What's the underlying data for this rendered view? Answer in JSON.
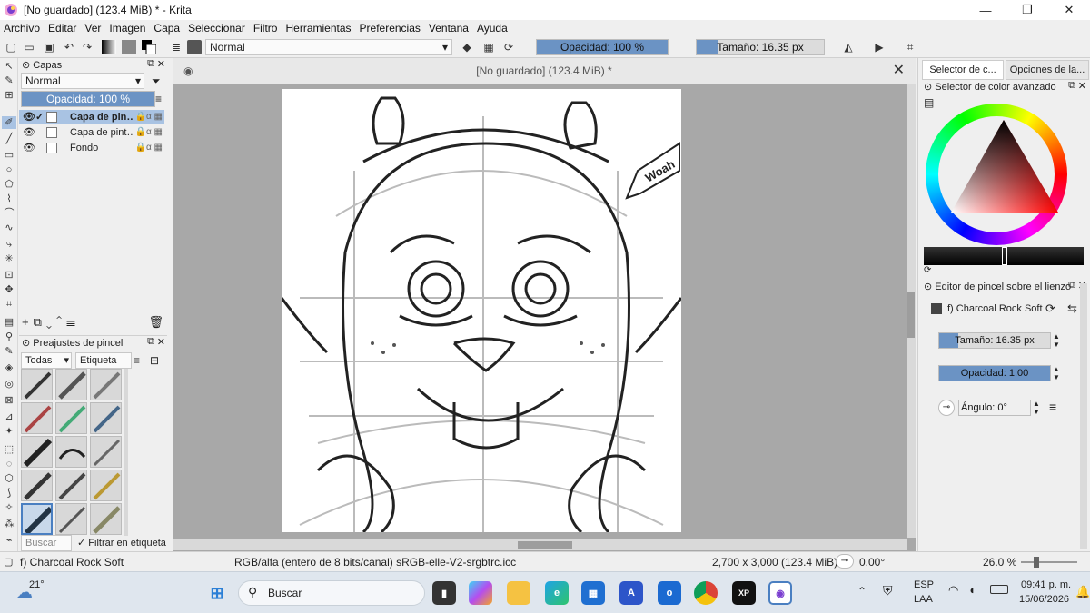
{
  "window": {
    "title": "[No guardado]  (123.4 MiB) * - Krita",
    "minimize": "—",
    "maximize": "❐",
    "close": "✕"
  },
  "menu": [
    "Archivo",
    "Editar",
    "Ver",
    "Imagen",
    "Capa",
    "Seleccionar",
    "Filtro",
    "Herramientas",
    "Preferencias",
    "Ventana",
    "Ayuda"
  ],
  "toolbar": {
    "blend_mode": "Normal",
    "opacity": "Opacidad: 100 %",
    "opacity_fraction": 1.0,
    "size": "Tamaño: 16.35 px",
    "size_fraction": 0.17
  },
  "layers_panel": {
    "title": "Capas",
    "blend_mode": "Normal",
    "opacity": "Opacidad: 100 %",
    "layers": [
      {
        "name": "Capa de pin…",
        "selected": true
      },
      {
        "name": "Capa de pint…",
        "selected": false
      },
      {
        "name": "Fondo",
        "selected": false
      }
    ]
  },
  "brush_presets": {
    "title": "Preajustes de pincel",
    "filter": "Todas",
    "tag": "Etiqueta",
    "search_placeholder": "Buscar",
    "filter_by_tag": "Filtrar en etiqueta"
  },
  "document": {
    "tab_title": "[No guardado]  (123.4 MiB) *",
    "speech_text": "Woah"
  },
  "right_dock": {
    "tab1": "Selector de c...",
    "tab2": "Opciones de la...",
    "advanced_color": "Selector de color avanzado",
    "brush_editor_title": "Editor de pincel sobre el lienzo",
    "brush_name": "f) Charcoal Rock Soft",
    "size": "Tamaño: 16.35 px",
    "opacity": "Opacidad: 1.00",
    "angle": "Ángulo: 0°"
  },
  "status": {
    "brush": "f) Charcoal Rock Soft",
    "color_info": "RGB/alfa (entero de 8 bits/canal)  sRGB-elle-V2-srgbtrc.icc",
    "dimensions": "2,700 x 3,000 (123.4 MiB)",
    "rotation": "0.00°",
    "zoom": "26.0 %"
  },
  "taskbar": {
    "temperature": "21°",
    "search": "Buscar",
    "lang1": "ESP",
    "lang2": "LAA",
    "time": "09:41 p. m.",
    "date": "15/06/2026"
  }
}
